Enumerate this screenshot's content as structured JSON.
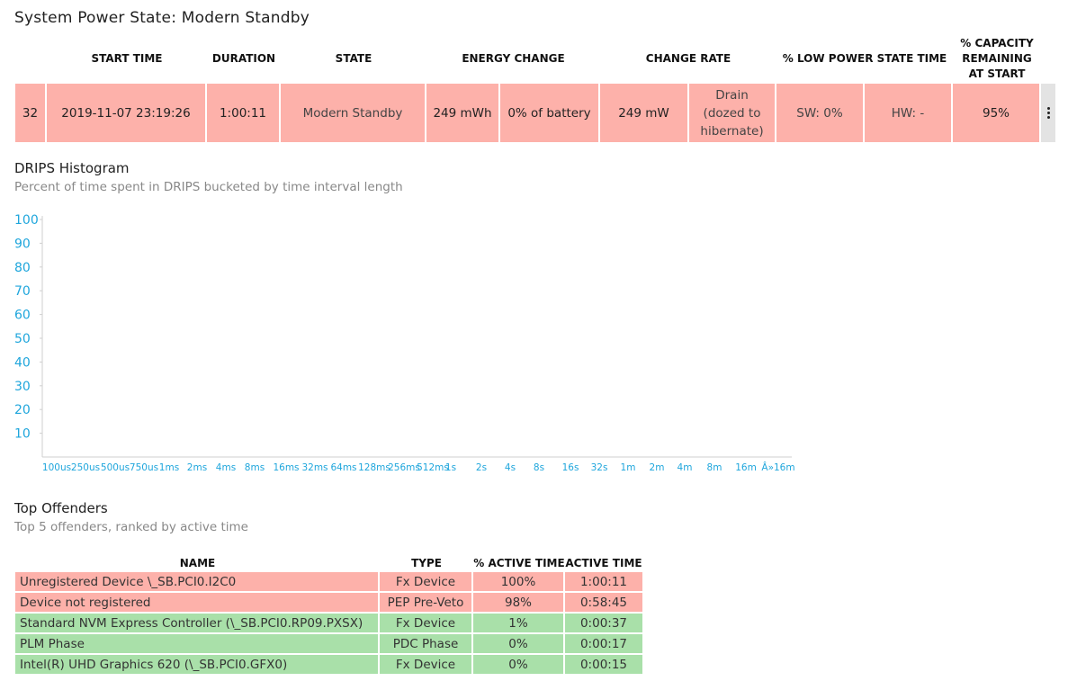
{
  "page_title": "System Power State: Modern Standby",
  "session": {
    "headers": {
      "start_time": "START TIME",
      "duration": "DURATION",
      "state": "STATE",
      "energy_change": "ENERGY CHANGE",
      "change_rate": "CHANGE RATE",
      "low_power": "% LOW POWER STATE TIME",
      "capacity_line1": "% CAPACITY",
      "capacity_line2": "REMAINING",
      "capacity_line3": "AT START"
    },
    "row": {
      "index": "32",
      "start_time": "2019-11-07  23:19:26",
      "duration": "1:00:11",
      "state": "Modern Standby",
      "energy_mwh": "249 mWh",
      "energy_pct": "0% of battery",
      "change_rate": "249 mW",
      "rate_note_1": "Drain",
      "rate_note_2": "(dozed to",
      "rate_note_3": "hibernate)",
      "sw": "SW: 0%",
      "hw": "HW: -",
      "capacity": "95%",
      "color": "#fdb1aa"
    },
    "menu_icon": "more-vertical-icon"
  },
  "histogram": {
    "title": "DRIPS Histogram",
    "subtitle": "Percent of time spent in DRIPS bucketed by time interval length"
  },
  "chart_data": {
    "type": "bar",
    "categories": [
      "100us",
      "250us",
      "500us",
      "750us",
      "1ms",
      "2ms",
      "4ms",
      "8ms",
      "16ms",
      "32ms",
      "64ms",
      "128ms",
      "256ms",
      "512ms",
      "1s",
      "2s",
      "4s",
      "8s",
      "16s",
      "32s",
      "1m",
      "2m",
      "4m",
      "8m",
      "16m",
      "Â»16m"
    ],
    "values": [
      0,
      0,
      0,
      0,
      0,
      0,
      0,
      0,
      0,
      0,
      0,
      0,
      0,
      0,
      0,
      0,
      0,
      0,
      0,
      0,
      0,
      0,
      0,
      0,
      0,
      0
    ],
    "yticks": [
      10,
      20,
      30,
      40,
      50,
      60,
      70,
      80,
      90,
      100
    ],
    "ylim": [
      0,
      100
    ],
    "tick_color": "#1fa6dc"
  },
  "offenders": {
    "title": "Top Offenders",
    "subtitle": "Top 5 offenders, ranked by active time",
    "headers": {
      "name": "NAME",
      "type": "TYPE",
      "pct": "% ACTIVE TIME",
      "active": "ACTIVE TIME"
    },
    "rows": [
      {
        "name": "Unregistered Device \\_SB.PCI0.I2C0",
        "type": "Fx Device",
        "pct": "100%",
        "active": "1:00:11",
        "status": "red"
      },
      {
        "name": "Device not registered",
        "type": "PEP Pre-Veto",
        "pct": "98%",
        "active": "0:58:45",
        "status": "red"
      },
      {
        "name": "Standard NVM Express Controller (\\_SB.PCI0.RP09.PXSX)",
        "type": "Fx Device",
        "pct": "1%",
        "active": "0:00:37",
        "status": "green"
      },
      {
        "name": "PLM Phase",
        "type": "PDC Phase",
        "pct": "0%",
        "active": "0:00:17",
        "status": "green"
      },
      {
        "name": "Intel(R) UHD Graphics 620 (\\_SB.PCI0.GFX0)",
        "type": "Fx Device",
        "pct": "0%",
        "active": "0:00:15",
        "status": "green"
      }
    ],
    "colors": {
      "red": "#fdb1aa",
      "green": "#a9e0a9"
    }
  }
}
